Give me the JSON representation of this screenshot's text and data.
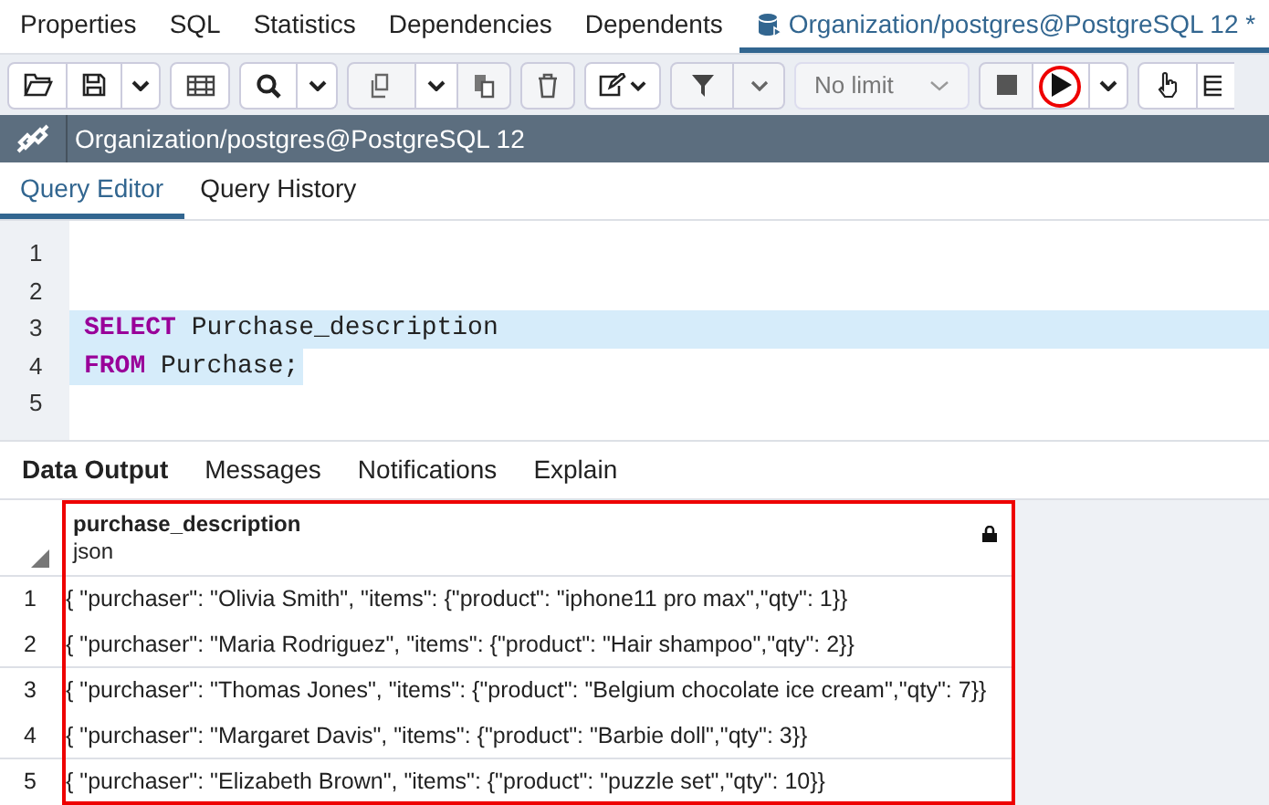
{
  "tabs": [
    {
      "label": "Properties",
      "selected": false
    },
    {
      "label": "SQL",
      "selected": false
    },
    {
      "label": "Statistics",
      "selected": false
    },
    {
      "label": "Dependencies",
      "selected": false
    },
    {
      "label": "Dependents",
      "selected": false
    },
    {
      "label": "Organization/postgres@PostgreSQL 12 *",
      "selected": true
    }
  ],
  "toolbar": {
    "limit_dropdown": "No limit"
  },
  "connection_bar": {
    "title": "Organization/postgres@PostgreSQL 12"
  },
  "editor_tabs": [
    {
      "label": "Query Editor",
      "selected": true
    },
    {
      "label": "Query History",
      "selected": false
    }
  ],
  "editor_lines": [
    {
      "number": "1",
      "selected": false
    },
    {
      "number": "2",
      "selected": false
    },
    {
      "number": "3",
      "keyword": "SELECT",
      "text": "Purchase_description",
      "selected": true
    },
    {
      "number": "4",
      "keyword": "FROM",
      "text": "Purchase;",
      "selected": true
    },
    {
      "number": "5",
      "selected": false
    }
  ],
  "output_tabs": [
    {
      "label": "Data Output",
      "selected": true
    },
    {
      "label": "Messages",
      "selected": false
    },
    {
      "label": "Notifications",
      "selected": false
    },
    {
      "label": "Explain",
      "selected": false
    }
  ],
  "grid": {
    "column": {
      "name": "purchase_description",
      "type": "json"
    },
    "rows": [
      {
        "number": "1",
        "value": "{ \"purchaser\": \"Olivia Smith\", \"items\": {\"product\": \"iphone11 pro max\",\"qty\": 1}}"
      },
      {
        "number": "2",
        "value": "{ \"purchaser\": \"Maria Rodriguez\", \"items\": {\"product\": \"Hair shampoo\",\"qty\": 2}}"
      },
      {
        "number": "3",
        "value": "{ \"purchaser\": \"Thomas Jones\", \"items\": {\"product\": \"Belgium chocolate ice cream\",\"qty\": 7}}"
      },
      {
        "number": "4",
        "value": "{ \"purchaser\": \"Margaret Davis\", \"items\": {\"product\": \"Barbie doll\",\"qty\": 3}}"
      },
      {
        "number": "5",
        "value": "{ \"purchaser\": \"Elizabeth Brown\", \"items\": {\"product\": \"puzzle set\",\"qty\": 10}}"
      }
    ]
  }
}
